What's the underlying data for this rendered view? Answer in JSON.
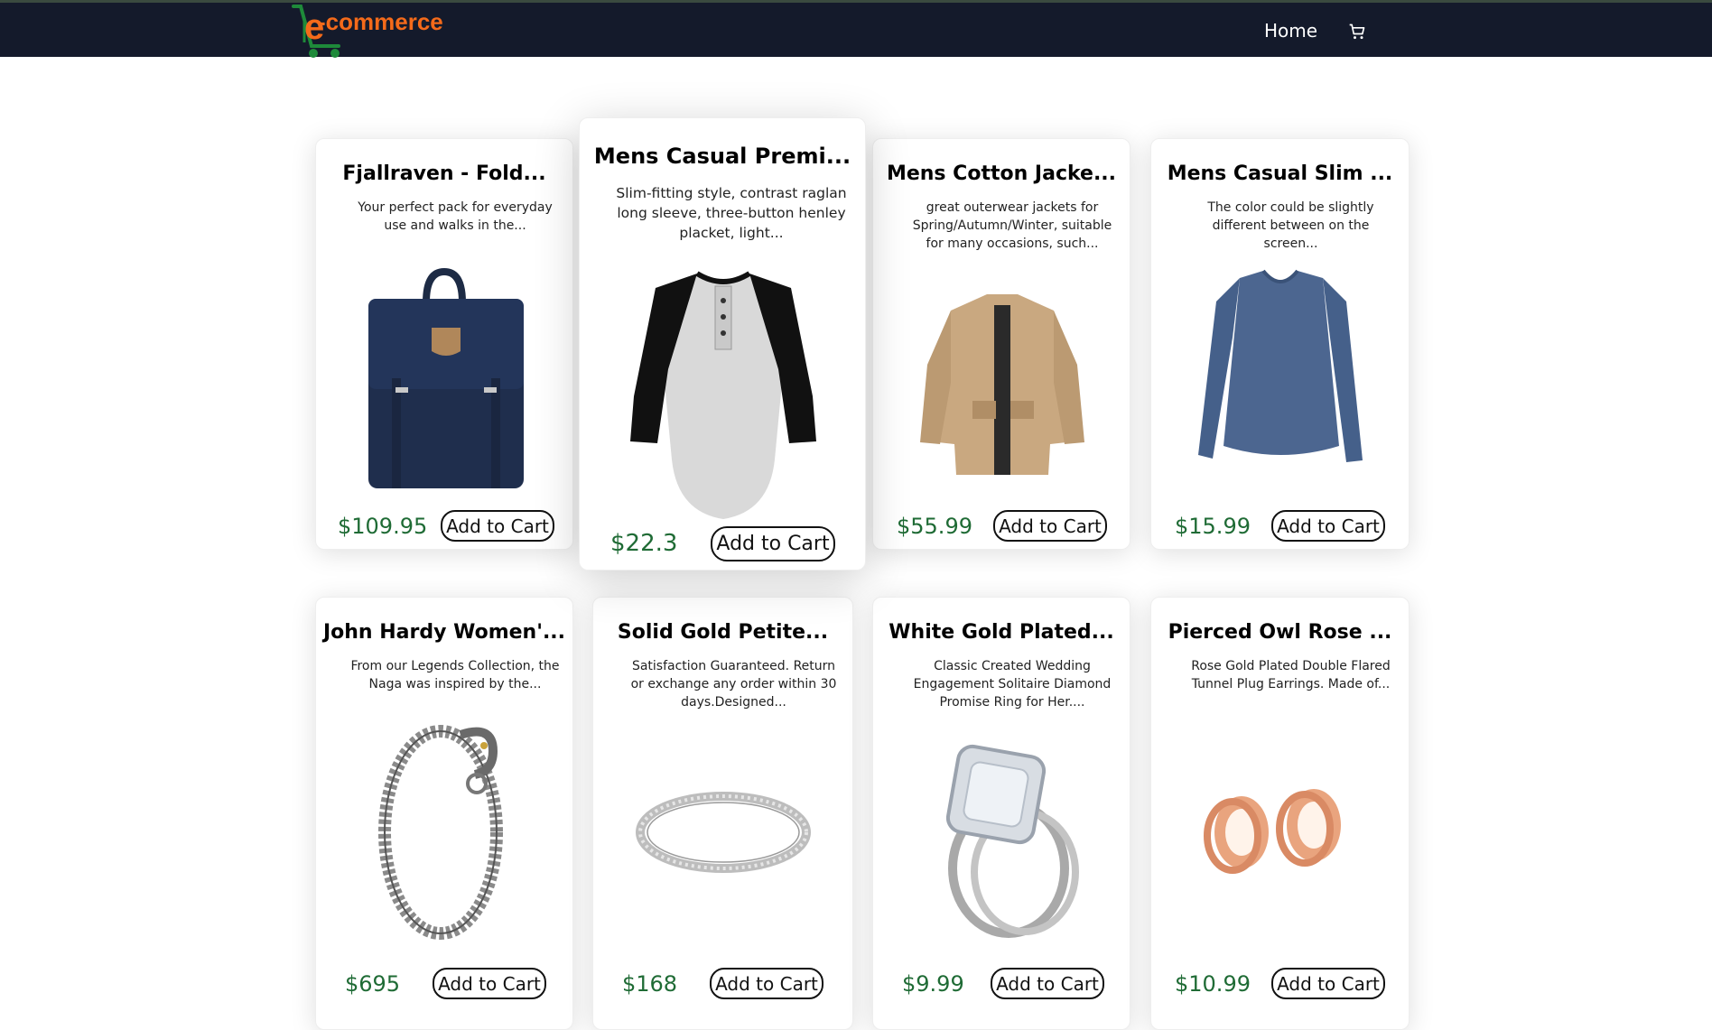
{
  "header": {
    "logo_text": "-commerce",
    "nav_home": "Home",
    "cart_icon": "shopping-cart-icon",
    "colors": {
      "nav_bg": "#141a2b",
      "logo_orange": "#f46a1a",
      "logo_green": "#1e8a3a"
    }
  },
  "products": [
    {
      "title": "Fjallraven - Fold...",
      "description": "Your perfect pack for everyday use and walks in the...",
      "price": "$109.95",
      "button": "Add to Cart",
      "image": "navy-backpack"
    },
    {
      "title": "Mens Casual Premi...",
      "description": "Slim-fitting style, contrast raglan long sleeve, three-button henley placket, light...",
      "price": "$22.3",
      "button": "Add to Cart",
      "image": "raglan-henley-shirt"
    },
    {
      "title": "Mens Cotton Jacke...",
      "description": "great outerwear jackets for Spring/Autumn/Winter, suitable for many occasions, such...",
      "price": "$55.99",
      "button": "Add to Cart",
      "image": "khaki-cotton-jacket"
    },
    {
      "title": "Mens Casual Slim ...",
      "description": "The color could be slightly different between on the screen...",
      "price": "$15.99",
      "button": "Add to Cart",
      "image": "blue-longsleeve-shirt"
    },
    {
      "title": "John Hardy Women'...",
      "description": "From our Legends Collection, the Naga was inspired by the...",
      "price": "$695",
      "button": "Add to Cart",
      "image": "dragon-chain-bracelet"
    },
    {
      "title": "Solid Gold Petite...",
      "description": "Satisfaction Guaranteed. Return or exchange any order within 30 days.Designed...",
      "price": "$168",
      "button": "Add to Cart",
      "image": "silver-band-ring"
    },
    {
      "title": "White Gold Plated...",
      "description": "Classic Created Wedding Engagement Solitaire Diamond Promise Ring for Her....",
      "price": "$9.99",
      "button": "Add to Cart",
      "image": "diamond-engagement-ring"
    },
    {
      "title": "Pierced Owl Rose ...",
      "description": "Rose Gold Plated Double Flared Tunnel Plug Earrings. Made of...",
      "price": "$10.99",
      "button": "Add to Cart",
      "image": "rose-gold-plug-earrings"
    }
  ]
}
